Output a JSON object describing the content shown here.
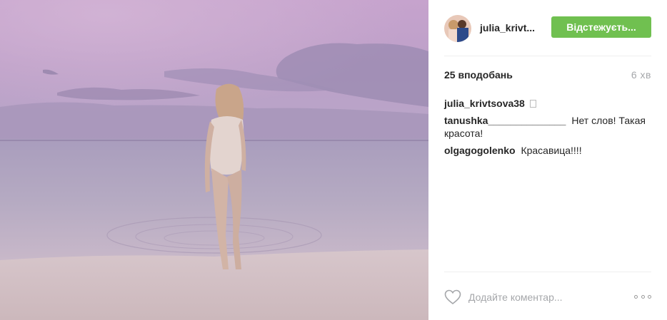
{
  "header": {
    "username": "julia_krivt...",
    "follow_label": "Відстежуєть..."
  },
  "stats": {
    "likes": "25 вподобань",
    "time": "6 хв"
  },
  "comments": [
    {
      "author": "julia_krivtsova38",
      "text": ""
    },
    {
      "author": "tanushka______________",
      "text": "Нет слов! Такая красота!"
    },
    {
      "author": "olgagogolenko",
      "text": "Красавица!!!!"
    }
  ],
  "footer": {
    "comment_placeholder": "Додайте коментар..."
  },
  "colors": {
    "follow_button": "#70c050",
    "muted_text": "#a5a7aa"
  },
  "icons": {
    "like": "heart-icon",
    "more": "more-options-icon"
  }
}
